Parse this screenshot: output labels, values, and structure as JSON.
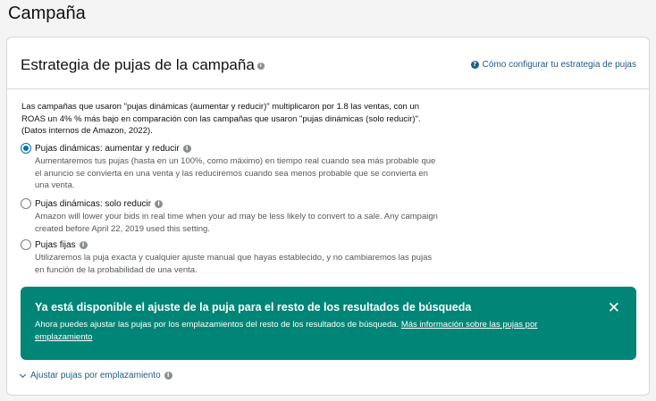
{
  "page": {
    "title": "Campaña"
  },
  "card": {
    "title": "Estrategia de pujas de la campaña",
    "help_link": "Cómo configurar tu estrategia de pujas",
    "intro": "Las campañas que usaron \"pujas dinámicas (aumentar y reducir)\" multiplicaron por 1.8 las ventas, con un ROAS un 4% % más bajo en comparación con las campañas que usaron \"pujas dinámicas (solo reducir)\". (Datos internos de Amazon, 2022)."
  },
  "options": [
    {
      "label": "Pujas dinámicas: aumentar y reducir",
      "selected": true,
      "desc": "Aumentaremos tus pujas (hasta en un 100%, como máximo) en tiempo real cuando sea más probable que el anuncio se convierta en una venta y las reduciremos cuando sea menos probable que se convierta en una venta."
    },
    {
      "label": "Pujas dinámicas: solo reducir",
      "selected": false,
      "desc": "Amazon will lower your bids in real time when your ad may be less likely to convert to a sale. Any campaign created before April 22, 2019 used this setting."
    },
    {
      "label": "Pujas fijas",
      "selected": false,
      "desc": "Utilizaremos la puja exacta y cualquier ajuste manual que hayas establecido, y no cambiaremos las pujas en función de la probabilidad de una venta."
    }
  ],
  "banner": {
    "title": "Ya está disponible el ajuste de la puja para el resto de los resultados de búsqueda",
    "text": "Ahora puedes ajustar las pujas por los emplazamientos del resto de los resultados de búsqueda.",
    "link": "Más información sobre las pujas por emplazamiento",
    "close": "✕",
    "color": "#008577"
  },
  "adjust_link": "Ajustar pujas por emplazamiento",
  "icons": {
    "info": "i",
    "help": "?"
  },
  "colors": {
    "accent": "#0070b1",
    "link": "#1f5b85"
  }
}
